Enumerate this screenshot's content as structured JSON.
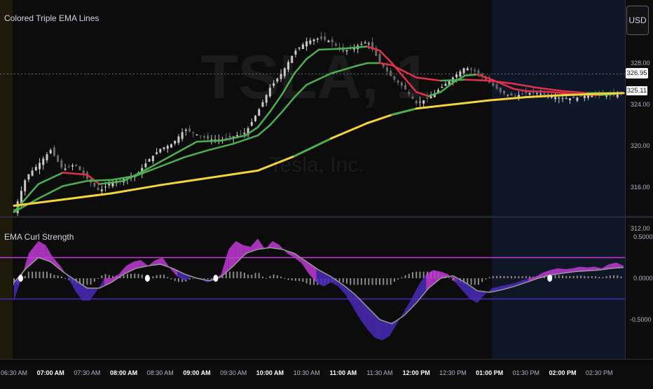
{
  "colors": {
    "background": "#0c0c0c",
    "premarket": "#1d1a0b",
    "selection": "#0f1626",
    "up_candle": "#c9c9c9",
    "down_candle": "#6a6a6a",
    "ema_bull": "#4caf50",
    "ema_bear": "#e0304b",
    "ema_slow": "#f5d33a",
    "curl_pos": "#c13ad6",
    "curl_neg": "#4a2bb8",
    "hist": "#8a8a8a",
    "upper_band": "#c13ad6",
    "lower_band": "#4a2bb8"
  },
  "toolbar": {
    "currency_label": "USD"
  },
  "watermark": {
    "symbol": "TSLA, 1",
    "name": "Tesla, Inc."
  },
  "main_pane": {
    "title": "Colored Triple EMA Lines",
    "price_ticks": [
      "328.00",
      "324.00",
      "320.00",
      "316.00",
      "312.00"
    ],
    "last_price_label": "326.95",
    "ema_price_label": "325.11"
  },
  "sub_pane": {
    "title": "EMA Curl Strength",
    "value_ticks": [
      "0.5000",
      "0.0000",
      "-0.5000"
    ]
  },
  "time_axis": {
    "labels": [
      {
        "text": "06:30 AM",
        "bold": false
      },
      {
        "text": "07:00 AM",
        "bold": true
      },
      {
        "text": "07:30 AM",
        "bold": false
      },
      {
        "text": "08:00 AM",
        "bold": true
      },
      {
        "text": "08:30 AM",
        "bold": false
      },
      {
        "text": "09:00 AM",
        "bold": true
      },
      {
        "text": "09:30 AM",
        "bold": false
      },
      {
        "text": "10:00 AM",
        "bold": true
      },
      {
        "text": "10:30 AM",
        "bold": false
      },
      {
        "text": "11:00 AM",
        "bold": true
      },
      {
        "text": "11:30 AM",
        "bold": false
      },
      {
        "text": "12:00 PM",
        "bold": true
      },
      {
        "text": "12:30 PM",
        "bold": false
      },
      {
        "text": "01:00 PM",
        "bold": true
      },
      {
        "text": "01:30 PM",
        "bold": false
      },
      {
        "text": "02:00 PM",
        "bold": true
      },
      {
        "text": "02:30 PM",
        "bold": false
      }
    ]
  },
  "chart_data": [
    {
      "type": "line",
      "title": "Colored Triple EMA Lines",
      "ylim": [
        311,
        331
      ],
      "x_unit": "minutes after 06:30 AM",
      "price_path": [
        [
          0,
          313.6
        ],
        [
          5,
          317
        ],
        [
          10,
          318.2
        ],
        [
          15,
          319.6
        ],
        [
          20,
          317.7
        ],
        [
          25,
          318.2
        ],
        [
          30,
          316.8
        ],
        [
          35,
          315.6
        ],
        [
          40,
          316.5
        ],
        [
          45,
          316.8
        ],
        [
          50,
          317.1
        ],
        [
          55,
          318.6
        ],
        [
          60,
          319.7
        ],
        [
          65,
          320.2
        ],
        [
          70,
          321.6
        ],
        [
          75,
          321.1
        ],
        [
          80,
          320.6
        ],
        [
          85,
          320.6
        ],
        [
          90,
          320.9
        ],
        [
          95,
          321.3
        ],
        [
          100,
          323.3
        ],
        [
          105,
          325.6
        ],
        [
          110,
          327.1
        ],
        [
          115,
          329.1
        ],
        [
          120,
          330.1
        ],
        [
          125,
          330.4
        ],
        [
          130,
          330.1
        ],
        [
          135,
          329.1
        ],
        [
          140,
          329.6
        ],
        [
          145,
          330.1
        ],
        [
          150,
          328.1
        ],
        [
          155,
          326.6
        ],
        [
          160,
          325.6
        ],
        [
          165,
          324.1
        ],
        [
          170,
          324.6
        ],
        [
          175,
          325.6
        ],
        [
          180,
          326.6
        ],
        [
          185,
          327.6
        ],
        [
          190,
          327.1
        ],
        [
          195,
          326.1
        ],
        [
          200,
          325.1
        ],
        [
          205,
          324.8
        ],
        [
          210,
          325.1
        ],
        [
          215,
          325.1
        ],
        [
          220,
          324.8
        ],
        [
          225,
          324.6
        ],
        [
          230,
          324.6
        ],
        [
          235,
          324.9
        ],
        [
          240,
          325.0
        ],
        [
          245,
          324.8
        ],
        [
          250,
          325.1
        ]
      ],
      "series": [
        {
          "role": "fast",
          "values": [
            [
              0,
              313.6
            ],
            [
              10,
              316.3
            ],
            [
              20,
              317.4
            ],
            [
              30,
              317.2
            ],
            [
              35,
              316.3
            ],
            [
              45,
              316.6
            ],
            [
              55,
              317.8
            ],
            [
              65,
              319.1
            ],
            [
              75,
              320.4
            ],
            [
              85,
              320.5
            ],
            [
              95,
              321
            ],
            [
              100,
              321.8
            ],
            [
              105,
              323.3
            ],
            [
              110,
              325.0
            ],
            [
              115,
              327.0
            ],
            [
              120,
              328.4
            ],
            [
              125,
              329.3
            ],
            [
              135,
              329.4
            ],
            [
              145,
              329.6
            ],
            [
              150,
              329.2
            ],
            [
              155,
              328.0
            ],
            [
              160,
              326.6
            ],
            [
              165,
              325.2
            ],
            [
              170,
              324.8
            ],
            [
              175,
              325.2
            ],
            [
              180,
              326.1
            ],
            [
              185,
              326.8
            ],
            [
              190,
              326.9
            ],
            [
              195,
              326.5
            ],
            [
              200,
              326.0
            ],
            [
              205,
              325.5
            ],
            [
              210,
              325.3
            ],
            [
              220,
              325.2
            ],
            [
              230,
              325.0
            ],
            [
              240,
              324.9
            ],
            [
              250,
              325.1
            ]
          ]
        },
        {
          "role": "medium",
          "values": [
            [
              0,
              313.6
            ],
            [
              10,
              314.9
            ],
            [
              20,
              316.1
            ],
            [
              30,
              316.6
            ],
            [
              40,
              316.7
            ],
            [
              50,
              317.1
            ],
            [
              60,
              318.0
            ],
            [
              70,
              318.9
            ],
            [
              80,
              319.6
            ],
            [
              90,
              320.2
            ],
            [
              100,
              321.0
            ],
            [
              105,
              322.0
            ],
            [
              110,
              323.3
            ],
            [
              115,
              324.7
            ],
            [
              120,
              325.9
            ],
            [
              130,
              327.0
            ],
            [
              140,
              327.7
            ],
            [
              145,
              328.0
            ],
            [
              150,
              328.0
            ],
            [
              155,
              327.8
            ],
            [
              160,
              327.2
            ],
            [
              165,
              326.6
            ],
            [
              175,
              326.3
            ],
            [
              185,
              326.4
            ],
            [
              195,
              326.3
            ],
            [
              205,
              326.0
            ],
            [
              215,
              325.6
            ],
            [
              225,
              325.3
            ],
            [
              235,
              325.1
            ],
            [
              250,
              325.1
            ]
          ]
        },
        {
          "role": "slow",
          "values": [
            [
              0,
              314.2
            ],
            [
              20,
              314.8
            ],
            [
              40,
              315.4
            ],
            [
              60,
              316.2
            ],
            [
              80,
              316.9
            ],
            [
              100,
              317.6
            ],
            [
              115,
              319.0
            ],
            [
              130,
              320.7
            ],
            [
              145,
              322.2
            ],
            [
              155,
              323.0
            ],
            [
              165,
              323.6
            ],
            [
              180,
              324.0
            ],
            [
              195,
              324.4
            ],
            [
              210,
              324.7
            ],
            [
              225,
              324.9
            ],
            [
              250,
              325.1
            ]
          ]
        }
      ]
    },
    {
      "type": "area",
      "title": "EMA Curl Strength",
      "ylim": [
        -0.82,
        0.72
      ],
      "upper_band": 0.25,
      "lower_band": -0.25,
      "curl": [
        [
          0,
          -0.27
        ],
        [
          3,
          0.0
        ],
        [
          6,
          0.3
        ],
        [
          10,
          0.45
        ],
        [
          13,
          0.4
        ],
        [
          16,
          0.25
        ],
        [
          19,
          0.15
        ],
        [
          22,
          0.02
        ],
        [
          25,
          -0.15
        ],
        [
          28,
          -0.27
        ],
        [
          31,
          -0.27
        ],
        [
          34,
          -0.15
        ],
        [
          37,
          0.0
        ],
        [
          40,
          0.0
        ],
        [
          43,
          0.05
        ],
        [
          46,
          0.15
        ],
        [
          49,
          0.2
        ],
        [
          52,
          0.22
        ],
        [
          55,
          0.15
        ],
        [
          58,
          0.22
        ],
        [
          61,
          0.25
        ],
        [
          64,
          0.12
        ],
        [
          67,
          0.02
        ],
        [
          70,
          -0.03
        ],
        [
          73,
          0.02
        ],
        [
          76,
          0.0
        ],
        [
          79,
          -0.05
        ],
        [
          82,
          -0.03
        ],
        [
          85,
          0.05
        ],
        [
          88,
          0.35
        ],
        [
          91,
          0.45
        ],
        [
          94,
          0.4
        ],
        [
          97,
          0.38
        ],
        [
          100,
          0.48
        ],
        [
          103,
          0.35
        ],
        [
          106,
          0.45
        ],
        [
          109,
          0.4
        ],
        [
          112,
          0.3
        ],
        [
          115,
          0.25
        ],
        [
          118,
          0.18
        ],
        [
          121,
          0.05
        ],
        [
          124,
          -0.05
        ],
        [
          127,
          -0.1
        ],
        [
          130,
          -0.05
        ],
        [
          133,
          -0.1
        ],
        [
          136,
          -0.2
        ],
        [
          139,
          -0.35
        ],
        [
          142,
          -0.5
        ],
        [
          145,
          -0.62
        ],
        [
          148,
          -0.72
        ],
        [
          151,
          -0.75
        ],
        [
          154,
          -0.7
        ],
        [
          157,
          -0.55
        ],
        [
          160,
          -0.4
        ],
        [
          163,
          -0.25
        ],
        [
          166,
          -0.08
        ],
        [
          169,
          0.05
        ],
        [
          172,
          0.1
        ],
        [
          175,
          0.08
        ],
        [
          178,
          0.05
        ],
        [
          181,
          -0.05
        ],
        [
          184,
          -0.15
        ],
        [
          187,
          -0.25
        ],
        [
          190,
          -0.3
        ],
        [
          193,
          -0.2
        ],
        [
          196,
          -0.12
        ],
        [
          199,
          -0.1
        ],
        [
          202,
          -0.08
        ],
        [
          205,
          -0.06
        ],
        [
          208,
          -0.03
        ],
        [
          211,
          0.0
        ],
        [
          214,
          0.02
        ],
        [
          217,
          0.07
        ],
        [
          220,
          0.1
        ],
        [
          223,
          0.12
        ],
        [
          226,
          0.11
        ],
        [
          229,
          0.12
        ],
        [
          232,
          0.14
        ],
        [
          235,
          0.13
        ],
        [
          238,
          0.14
        ],
        [
          241,
          0.12
        ],
        [
          244,
          0.17
        ],
        [
          247,
          0.19
        ],
        [
          250,
          0.15
        ]
      ],
      "signal": [
        [
          0,
          -0.05
        ],
        [
          5,
          0.12
        ],
        [
          10,
          0.25
        ],
        [
          15,
          0.2
        ],
        [
          20,
          0.08
        ],
        [
          25,
          -0.02
        ],
        [
          30,
          -0.12
        ],
        [
          35,
          -0.12
        ],
        [
          40,
          -0.05
        ],
        [
          45,
          0.05
        ],
        [
          50,
          0.12
        ],
        [
          55,
          0.15
        ],
        [
          60,
          0.17
        ],
        [
          65,
          0.12
        ],
        [
          70,
          0.05
        ],
        [
          75,
          0.0
        ],
        [
          80,
          -0.03
        ],
        [
          85,
          0.02
        ],
        [
          90,
          0.15
        ],
        [
          95,
          0.3
        ],
        [
          100,
          0.35
        ],
        [
          105,
          0.37
        ],
        [
          110,
          0.35
        ],
        [
          115,
          0.3
        ],
        [
          120,
          0.2
        ],
        [
          125,
          0.1
        ],
        [
          130,
          0.02
        ],
        [
          135,
          -0.08
        ],
        [
          140,
          -0.2
        ],
        [
          145,
          -0.35
        ],
        [
          150,
          -0.5
        ],
        [
          155,
          -0.55
        ],
        [
          160,
          -0.45
        ],
        [
          165,
          -0.3
        ],
        [
          170,
          -0.12
        ],
        [
          175,
          0.0
        ],
        [
          180,
          0.03
        ],
        [
          185,
          -0.05
        ],
        [
          190,
          -0.15
        ],
        [
          195,
          -0.17
        ],
        [
          200,
          -0.14
        ],
        [
          205,
          -0.1
        ],
        [
          210,
          -0.05
        ],
        [
          215,
          0.0
        ],
        [
          220,
          0.04
        ],
        [
          225,
          0.06
        ],
        [
          230,
          0.08
        ],
        [
          235,
          0.09
        ],
        [
          240,
          0.1
        ],
        [
          245,
          0.12
        ],
        [
          250,
          0.13
        ]
      ],
      "cross_markers_x": [
        1,
        53,
        81,
        218
      ]
    }
  ]
}
